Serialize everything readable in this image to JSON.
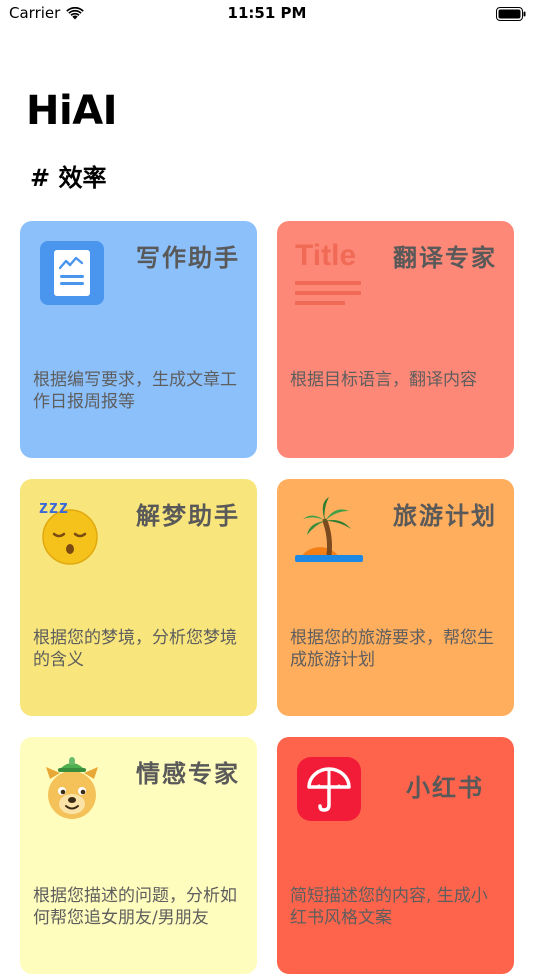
{
  "status_bar": {
    "carrier": "Carrier",
    "time": "11:51 PM"
  },
  "page_title": "HiAI",
  "section_header": "# 效率",
  "cards": [
    {
      "title": "写作助手",
      "description": "根据编写要求，生成文章工作日报周报等",
      "color": "#8cc0fb",
      "icon": "document-chart-icon"
    },
    {
      "title": "翻译专家",
      "description": "根据目标语言，翻译内容",
      "color": "#fe8877",
      "icon": "title-text-icon",
      "icon_text": "Title"
    },
    {
      "title": "解梦助手",
      "description": "根据您的梦境，分析您梦境的含义",
      "color": "#f8e67c",
      "icon": "sleeping-face-icon",
      "icon_text": "zzz"
    },
    {
      "title": "旅游计划",
      "description": "根据您的旅游要求，帮您生成旅游计划",
      "color": "#ffae5e",
      "icon": "palm-island-icon"
    },
    {
      "title": "情感专家",
      "description": "根据您描述的问题，分析如何帮您追女朋友/男朋友",
      "color": "#fffdbd",
      "icon": "dog-face-icon"
    },
    {
      "title": "小红书",
      "description": "简短描述您的内容, 生成小红书风格文案",
      "color": "#fe644c",
      "icon": "xiaohongshu-umbrella-icon"
    }
  ]
}
